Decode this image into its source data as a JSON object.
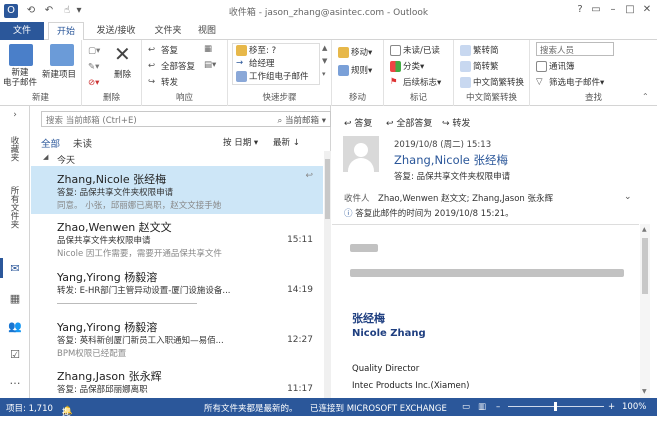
{
  "window": {
    "title": "收件箱 - jason_zhang@asintec.com - Outlook",
    "help": "?"
  },
  "tabs": [
    "文件",
    "开始",
    "发送/接收",
    "文件夹",
    "视图"
  ],
  "ribbon": {
    "new": {
      "new_email": "新建\n电子邮件",
      "new_items": "新建项目",
      "label": "新建"
    },
    "delete": {
      "delete_btn": "删除",
      "label": "删除"
    },
    "respond": {
      "reply": "答复",
      "reply_all": "全部答复",
      "forward": "转发",
      "label": "响应"
    },
    "quicksteps": {
      "items": [
        "移至: ?",
        "给经理",
        "工作组电子邮件"
      ],
      "label": "快速步骤"
    },
    "move": {
      "move_btn": "移动",
      "rules": "规则",
      "label": "移动"
    },
    "tags": {
      "unread": "未读/已读",
      "categorize": "分类",
      "followup": "后续标志",
      "label": "标记"
    },
    "chinese": {
      "to_trad": "繁转简",
      "to_simp": "简转繁",
      "convert": "中文简繁转换",
      "label": "中文简繁转换"
    },
    "find": {
      "search_people": "搜索人员",
      "address_book": "通讯簿",
      "filter": "筛选电子邮件",
      "label": "查找"
    }
  },
  "leftnav": {
    "favorites": "收藏夹",
    "all_folders": "所有文件夹"
  },
  "list": {
    "search_placeholder": "搜索 当前邮箱 (Ctrl+E)",
    "search_scope": "当前邮箱",
    "filter_all": "全部",
    "filter_unread": "未读",
    "sort_by": "按 日期",
    "sort_order": "最新",
    "group_today": "今天",
    "messages": [
      {
        "from": "Zhang,Nicole 张经梅",
        "subject": "答复: 品保共享文件夹权限申请",
        "preview": "同意。 小张，邱丽娜已离职，赵文文接手她",
        "time": ""
      },
      {
        "from": "Zhao,Wenwen 赵文文",
        "subject": "品保共享文件夹权限申请",
        "preview": "Nicole 因工作需要，需要开通品保共享文件",
        "time": "15:11"
      },
      {
        "from": "Yang,Yirong 杨毅溶",
        "subject": "转发: E-HR部门主管异动设置-厦门设施设备...",
        "preview": "",
        "time": "14:19"
      },
      {
        "from": "Yang,Yirong 杨毅溶",
        "subject": "答复: 英科新创厦门新员工入职通知—易佰...",
        "preview": "BPM权限已经配置",
        "time": "12:27"
      },
      {
        "from": "Zhang,Jason 张永辉",
        "subject": "答复: 品保部邱丽娜离职",
        "preview": "",
        "time": "11:17"
      }
    ]
  },
  "reading": {
    "reply": "答复",
    "reply_all": "全部答复",
    "forward": "转发",
    "date": "2019/10/8 (周二) 15:13",
    "sender": "Zhang,Nicole 张经梅",
    "subject": "答复: 品保共享文件夹权限申请",
    "to_label": "收件人",
    "recipients": "Zhao,Wenwen 赵文文; Zhang,Jason 张永辉",
    "info": "答复此邮件的时间为 2019/10/8 15:21。",
    "sign_cn": "张经梅",
    "sign_en": "Nicole Zhang",
    "position": "Quality Director",
    "company": "Intec Products Inc.(Xiamen)"
  },
  "status": {
    "items": "项目: 1,710",
    "reminders": "提醒: 3",
    "folders": "所有文件夹都是最新的。",
    "connected": "已连接到 MICROSOFT EXCHANGE",
    "zoom": "100%"
  },
  "colors": {
    "accent": "#2b579a",
    "sender": "#2b579a",
    "sign": "#1f3f80"
  }
}
